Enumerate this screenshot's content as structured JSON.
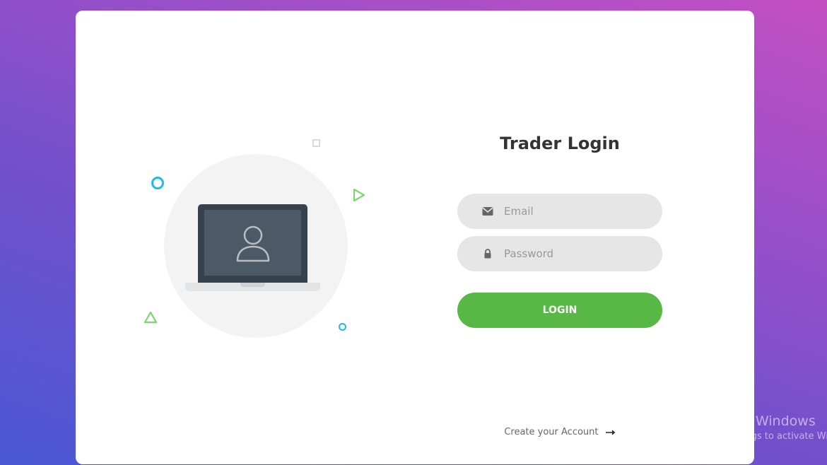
{
  "login": {
    "title": "Trader Login",
    "email_placeholder": "Email",
    "password_placeholder": "Password",
    "login_label": "LOGIN",
    "create_account_label": "Create your Account"
  },
  "icons": {
    "email": "envelope-icon",
    "password": "lock-icon",
    "create_account": "arrow-right-icon",
    "illustration": "user-icon"
  },
  "colors": {
    "accent_green": "#57b846",
    "deco_cyan": "#1ebbe8",
    "deco_green": "#7ed56f",
    "field_bg": "#e6e6e6"
  },
  "watermark": {
    "title": "Activate Windows",
    "subtitle": "Go to Settings to activate Windows."
  }
}
